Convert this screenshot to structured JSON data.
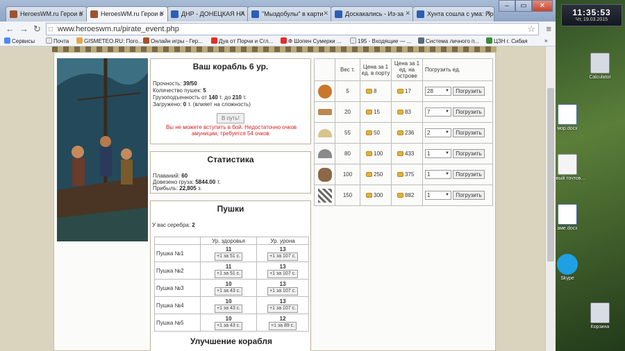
{
  "browser": {
    "tabs": [
      {
        "title": "HeroesWM.ru Герои в"
      },
      {
        "title": "HeroesWM.ru Герои в"
      },
      {
        "title": "ДНР - ДОНЕЦКАЯ НА"
      },
      {
        "title": "\"Мыздобулы\" в карти"
      },
      {
        "title": "Доскакались - Из-за"
      },
      {
        "title": "Хунта сошла с ума: Пр"
      }
    ],
    "url": "www.heroeswm.ru/pirate_event.php",
    "bookmarks": [
      "Сервисы",
      "Почта",
      "GISMETEO.RU: Пого...",
      "Онлайн игры - Гер...",
      "Дуа от Порчи и Сгл...",
      "Ф Шопен Сумерки ...",
      "195 - Входящие — ...",
      "Система личного п...",
      "ЦЗН г. Сибая"
    ]
  },
  "ship": {
    "title": "Ваш корабль 6 ур.",
    "durability_label": "Прочность:",
    "durability": "39/50",
    "cannons_label": "Количество пушек:",
    "cannons": "5",
    "capacity_label": "Грузоподъенность от",
    "capacity_from": "140",
    "capacity_mid": "т. до",
    "capacity_to": "210",
    "capacity_unit": "т.",
    "loaded_label": "Загружено:",
    "loaded": "0",
    "loaded_unit": "т.",
    "loaded_note": "(влияет на сложность)",
    "go_button": "В путь!",
    "warning": "Вы не можете вступить в бой. Недостаточно очков амуниции, требуется 54 очков."
  },
  "stats": {
    "title": "Статистика",
    "voyages_label": "Плаваний:",
    "voyages": "60",
    "delivered_label": "Довезено груза:",
    "delivered": "5844.00",
    "delivered_unit": "т.",
    "profit_label": "Прибыль:",
    "profit": "22,805",
    "profit_unit": "з."
  },
  "guns": {
    "title": "Пушки",
    "silver_label": "У вас серебра:",
    "silver": "2",
    "col_health": "Ур. здоровья",
    "col_damage": "Ур. урона",
    "rows": [
      {
        "name": "Пушка №1",
        "health": "11",
        "health_btn": "+1 за 51 с.",
        "damage": "13",
        "damage_btn": "+1 за 107 с."
      },
      {
        "name": "Пушка №2",
        "health": "11",
        "health_btn": "+1 за 51 с.",
        "damage": "13",
        "damage_btn": "+1 за 107 с."
      },
      {
        "name": "Пушка №3",
        "health": "10",
        "health_btn": "+1 за 43 с.",
        "damage": "13",
        "damage_btn": "+1 за 107 с."
      },
      {
        "name": "Пушка №4",
        "health": "10",
        "health_btn": "+1 за 43 с.",
        "damage": "13",
        "damage_btn": "+1 за 107 с."
      },
      {
        "name": "Пушка №5",
        "health": "10",
        "health_btn": "+1 за 43 с.",
        "damage": "12",
        "damage_btn": "+1 за 89 с."
      }
    ],
    "upgrade_title": "Улучшение корабля"
  },
  "cargo": {
    "col_weight": "Вес т.",
    "col_port": "Цена за 1 ед. в порту",
    "col_island": "Цена за 1 ед. на острове",
    "col_load": "Погрузить ед.",
    "load_button": "Погрузить",
    "rows": [
      {
        "icon": "fruit-basket-icon",
        "weight": "5",
        "port": "8",
        "island": "17",
        "qty": "28",
        "color": "#c9772b"
      },
      {
        "icon": "wood-planks-icon",
        "weight": "20",
        "port": "15",
        "island": "83",
        "qty": "7",
        "color": "#b9894f"
      },
      {
        "icon": "sand-pile-icon",
        "weight": "55",
        "port": "50",
        "island": "236",
        "qty": "2",
        "color": "#d8c48a"
      },
      {
        "icon": "ore-pile-icon",
        "weight": "80",
        "port": "100",
        "island": "433",
        "qty": "1",
        "color": "#8a8a8a"
      },
      {
        "icon": "clay-pot-icon",
        "weight": "100",
        "port": "250",
        "island": "375",
        "qty": "1",
        "color": "#8c6848"
      },
      {
        "icon": "iron-bars-icon",
        "weight": "150",
        "port": "300",
        "island": "882",
        "qty": "1",
        "color": "#6a6a6a"
      }
    ]
  },
  "desktop": {
    "time": "11:35:53",
    "date": "Чт, 19.03.2015",
    "icons": [
      "Calculator",
      "мор.docx",
      "Новый точтов...",
      "аме.docx",
      "Skype",
      "Корзина"
    ]
  }
}
